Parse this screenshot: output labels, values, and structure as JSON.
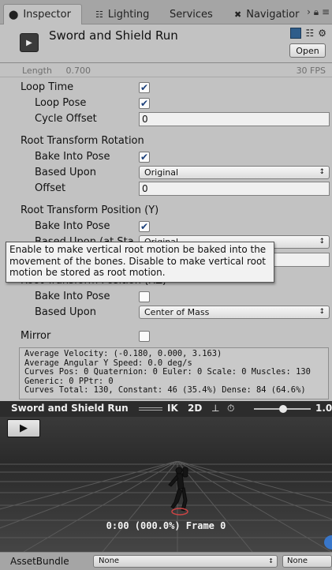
{
  "tabs": [
    {
      "label": "Inspector",
      "icon": "info-icon"
    },
    {
      "label": "Lighting",
      "icon": "lighting-icon"
    },
    {
      "label": "Services",
      "icon": ""
    },
    {
      "label": "Navigatior",
      "icon": "navigation-icon"
    }
  ],
  "header": {
    "title": "Sword and Shield Run",
    "open_label": "Open"
  },
  "info": {
    "length_label": "Length",
    "length_value": "0.700",
    "fps": "30 FPS"
  },
  "loop": {
    "loop_time_label": "Loop Time",
    "loop_time_checked": true,
    "loop_pose_label": "Loop Pose",
    "loop_pose_checked": true,
    "cycle_offset_label": "Cycle Offset",
    "cycle_offset_value": "0"
  },
  "root_rotation": {
    "title": "Root Transform Rotation",
    "bake_label": "Bake Into Pose",
    "bake_checked": true,
    "based_upon_label": "Based Upon",
    "based_upon_value": "Original",
    "offset_label": "Offset",
    "offset_value": "0"
  },
  "root_position_y": {
    "title": "Root Transform Position (Y)",
    "bake_label": "Bake Into Pose",
    "bake_checked": true,
    "based_upon_label": "Based Upon (at Sta",
    "based_upon_value": "Original"
  },
  "tooltip": "Enable to make vertical root motion be baked into the movement of the bones. Disable to make vertical root motion be stored as root motion.",
  "root_position_xz": {
    "title": "Root Transform Position (XZ)",
    "bake_label": "Bake Into Pose",
    "bake_checked": false,
    "based_upon_label": "Based Upon",
    "based_upon_value": "Center of Mass"
  },
  "mirror": {
    "label": "Mirror",
    "checked": false
  },
  "stats": [
    "Average Velocity: (-0.180, 0.000, 3.163)",
    "Average Angular Y Speed: 0.0 deg/s",
    "Curves Pos: 0 Quaternion: 0 Euler: 0 Scale: 0 Muscles: 130",
    "Generic: 0 PPtr: 0",
    "Curves Total: 130, Constant: 46 (35.4%) Dense: 84 (64.6%)"
  ],
  "preview": {
    "clip_name": "Sword and Shield Run",
    "ik_label": "IK",
    "twod_label": "2D",
    "speed_value": "1.0",
    "timecode": "0:00 (000.0%) Frame 0"
  },
  "bundle": {
    "label": "AssetBundle",
    "name_value": "None",
    "variant_value": "None"
  }
}
